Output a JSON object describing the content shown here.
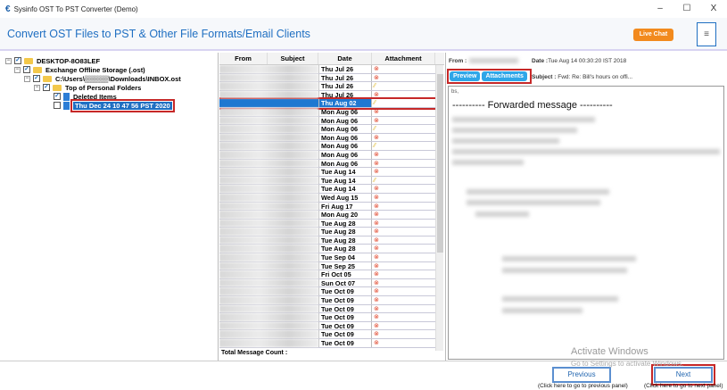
{
  "window": {
    "title": "Sysinfo OST To PST Converter (Demo)",
    "minimize": "–",
    "maximize": "☐",
    "close": "X"
  },
  "header": {
    "title": "Convert OST Files to PST & Other File Formats/Email Clients",
    "live_chat": "Live Chat",
    "menu": "≡"
  },
  "tree": [
    {
      "label": "DESKTOP-8O83LEF"
    },
    {
      "label": "Exchange Offline Storage (.ost)"
    },
    {
      "label": "C:\\Users\\▒▒▒▒▒\\Downloads\\INBOX.ost"
    },
    {
      "label": "Top of Personal Folders"
    },
    {
      "label": "Deleted Items"
    },
    {
      "label": "Thu Dec 24 10 47 56 PST 2020"
    }
  ],
  "list": {
    "columns": [
      "From",
      "Subject",
      "Date",
      "Attachment"
    ],
    "rows": [
      {
        "date": "Thu Jul 26",
        "att": "x"
      },
      {
        "date": "Thu Jul 26",
        "att": "x"
      },
      {
        "date": "Thu Jul 26",
        "att": "clip"
      },
      {
        "date": "Thu Jul 26",
        "att": "x"
      },
      {
        "date": "Thu Aug 02",
        "att": "clip",
        "selected": true
      },
      {
        "date": "Mon Aug 06",
        "att": "x"
      },
      {
        "date": "Mon Aug 06",
        "att": "x"
      },
      {
        "date": "Mon Aug 06",
        "att": "clip"
      },
      {
        "date": "Mon Aug 06",
        "att": "x"
      },
      {
        "date": "Mon Aug 06",
        "att": "clip"
      },
      {
        "date": "Mon Aug 06",
        "att": "x"
      },
      {
        "date": "Mon Aug 06",
        "att": "x"
      },
      {
        "date": "Tue Aug 14",
        "att": "x"
      },
      {
        "date": "Tue Aug 14",
        "att": "clip"
      },
      {
        "date": "Tue Aug 14",
        "att": "x"
      },
      {
        "date": "Wed Aug 15",
        "att": "x"
      },
      {
        "date": "Fri Aug 17",
        "att": "x"
      },
      {
        "date": "Mon Aug 20",
        "att": "x"
      },
      {
        "date": "Tue Aug 28",
        "att": "x"
      },
      {
        "date": "Tue Aug 28",
        "att": "x"
      },
      {
        "date": "Tue Aug 28",
        "att": "x"
      },
      {
        "date": "Tue Aug 28",
        "att": "x"
      },
      {
        "date": "Tue Sep 04",
        "att": "x"
      },
      {
        "date": "Tue Sep 25",
        "att": "x"
      },
      {
        "date": "Fri Oct 05",
        "att": "x"
      },
      {
        "date": "Sun Oct 07",
        "att": "x"
      },
      {
        "date": "Tue Oct 09",
        "att": "x"
      },
      {
        "date": "Tue Oct 09",
        "att": "x"
      },
      {
        "date": "Tue Oct 09",
        "att": "x"
      },
      {
        "date": "Tue Oct 09",
        "att": "x"
      },
      {
        "date": "Tue Oct 09",
        "att": "x"
      },
      {
        "date": "Tue Oct 09",
        "att": "x"
      },
      {
        "date": "Tue Oct 09",
        "att": "x"
      }
    ],
    "total_label": "Total Message Count :"
  },
  "preview": {
    "from_label": "From :",
    "date_label": "Date :",
    "date": "Tue Aug 14 00:30:20 IST 2018",
    "subject_label": "Subject :",
    "subject": "Fwd: Re: Bill's hours on offi...",
    "tab_preview": "Preview",
    "tab_attachments": "Attachments",
    "greeting": "bs,",
    "forwarded": "---------- Forwarded message ----------"
  },
  "footer": {
    "previous": "Previous",
    "previous_hint": "(Click here to go to previous panel)",
    "next": "Next",
    "next_hint": "(Click here to go to next panel)"
  },
  "watermark": {
    "line1": "Activate Windows",
    "line2": "Go to Settings to activate Windows."
  }
}
